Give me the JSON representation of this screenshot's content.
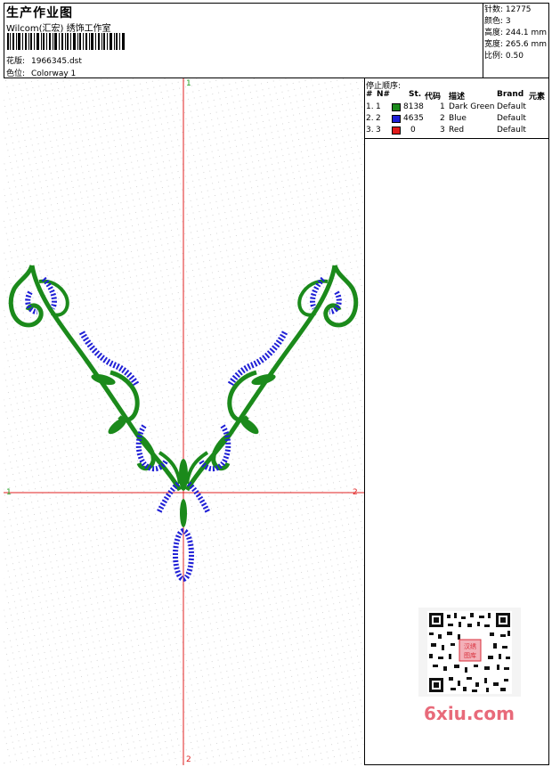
{
  "header": {
    "title": "生产作业图",
    "company": "Wilcom(汇宏) 绣饰工作室",
    "design_label": "花版:",
    "design_value": "1966345.dst",
    "colorway_label": "色位:",
    "colorway_value": "Colorway 1"
  },
  "stats": {
    "stitches": "针数: 12775",
    "colors": "颜色: 3",
    "height": "高度: 244.1 mm",
    "width": "宽度: 265.6 mm",
    "scale": "比例: 0.50"
  },
  "legend": {
    "caption": "停止顺序:",
    "columns": [
      "#",
      "N#",
      "St.",
      "代码",
      "描述",
      "Brand",
      "元素"
    ],
    "rows": [
      {
        "idx": "1.",
        "n": "1",
        "color": "#1b8a1b",
        "st": "8138",
        "code": "1",
        "desc": "Dark Green",
        "brand": "Default"
      },
      {
        "idx": "2.",
        "n": "2",
        "color": "#1f1fd6",
        "st": "4635",
        "code": "2",
        "desc": "Blue",
        "brand": "Default"
      },
      {
        "idx": "3.",
        "n": "3",
        "color": "#e01b1b",
        "st": "0",
        "code": "3",
        "desc": "Red",
        "brand": "Default"
      }
    ]
  },
  "axes": {
    "top": "1",
    "left": "1",
    "right": "2",
    "bottom": "2"
  },
  "watermark": {
    "text": "6xiu.com",
    "seal": "汉绣图库"
  },
  "colors": {
    "green": "#1b8a1b",
    "blue": "#1f1fd6",
    "red": "#e01b1b",
    "axis": "#e02020"
  }
}
